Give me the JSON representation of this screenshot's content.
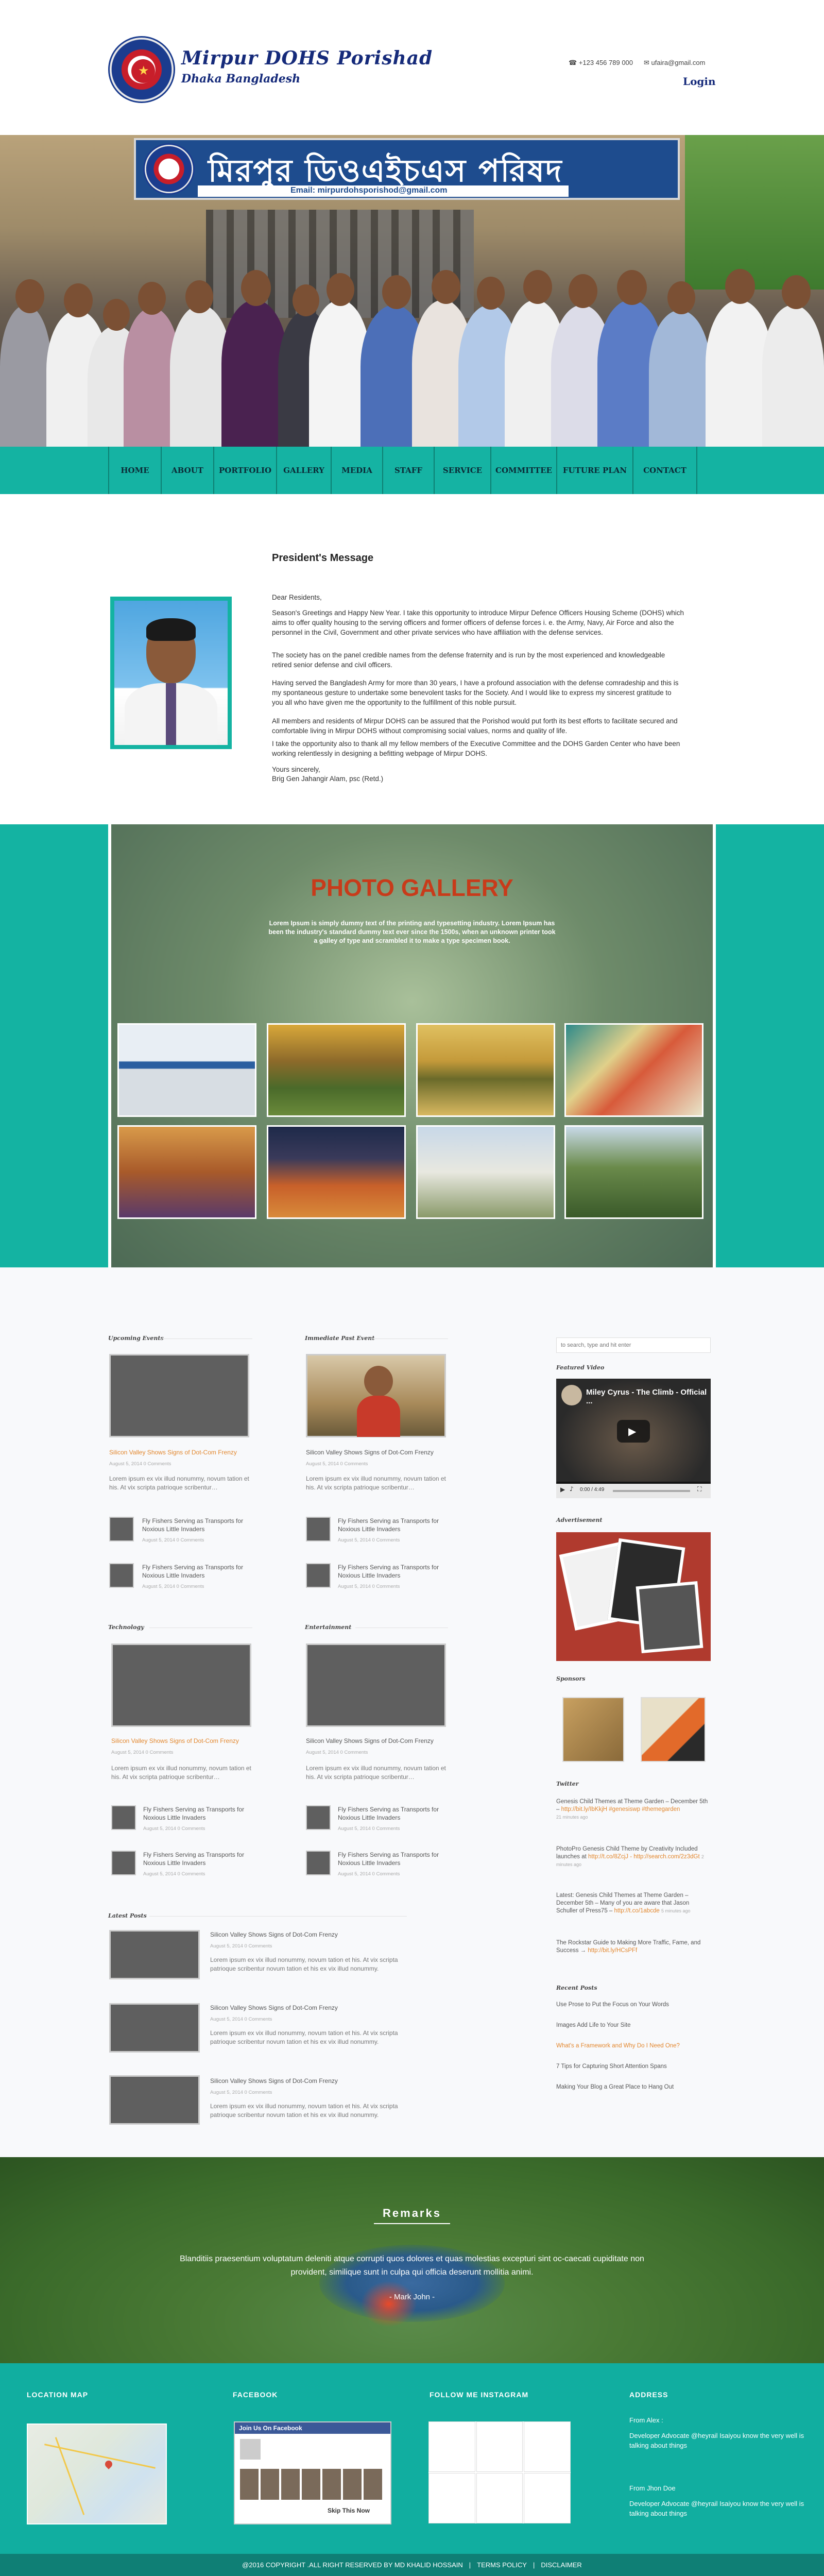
{
  "header": {
    "site_title": "Mirpur DOHS Porishad",
    "site_subtitle": "Dhaka Bangladesh",
    "phone": "+123 456 789 000",
    "email": "ufaira@gmail.com",
    "login": "Login"
  },
  "hero": {
    "sign_text": "মিরপুর ডিওএইচএস পরিষদ",
    "sign_email": "Email: mirpurdohsporishod@gmail.com"
  },
  "nav": [
    "HOME",
    "ABOUT",
    "PORTFOLIO",
    "GALLERY",
    "MEDIA",
    "STAFF",
    "SERVICE",
    "COMMITTEE",
    "FUTURE PLAN",
    "CONTACT"
  ],
  "president": {
    "title": "President's Message",
    "salutation": "Dear Residents,",
    "p1": "Season's Greetings and Happy New Year. I take this opportunity to introduce Mirpur Defence Officers Housing Scheme (DOHS) which aims to offer quality housing to the serving officers and former officers of defense forces i. e. the Army, Navy, Air Force and also the personnel in the Civil, Government and other private services who have affiliation with the defense services.",
    "p2": "The society has on the panel credible names from the defense fraternity and is run by the most experienced and knowledgeable retired senior defense and civil officers.",
    "p3": "Having served the Bangladesh Army for more than 30 years, I have a profound association with the defense comradeship and this is my spontaneous gesture to undertake some benevolent tasks for the Society. And I would like to express my sincerest gratitude to you all who have given me the opportunity to the fulfillment of this noble pursuit.",
    "p4": "All members and residents of Mirpur DOHS can be assured that the Porishod would put forth its best efforts to facilitate secured and comfortable living in Mirpur DOHS without compromising social values, norms and quality of life.",
    "p5": "I take the opportunity also to thank all my fellow members of the Executive Committee and the DOHS Garden Center who have been working relentlessly in designing a befitting webpage of Mirpur DOHS.",
    "closing": "Yours sincerely,",
    "signature": "Brig Gen Jahangir Alam, psc (Retd.)"
  },
  "gallery": {
    "title": "PHOTO GALLERY",
    "description": "Lorem Ipsum is simply dummy text of the printing and typesetting industry. Lorem Ipsum has been the industry's standard dummy text ever since the 1500s, when an unknown printer took a galley of type and scrambled it to make a type specimen book."
  },
  "content": {
    "upcoming_label": "Upcoming Events",
    "immediate_label": "Immediate Past Event",
    "technology_label": "Technology",
    "entertainment_label": "Entertainment",
    "latest_label": "Latest Posts",
    "main_title": "Silicon Valley Shows Signs of Dot-Com Frenzy",
    "main_meta": "August 5, 2014   0 Comments",
    "main_text": "Lorem ipsum ex vix illud nonummy, novum tation et his. At vix scripta patrioque scribentur…",
    "small_title": "Fly Fishers Serving as Transports for Noxious Little Invaders",
    "small_meta": "August 5, 2014   0 Comments",
    "latest_text": "Lorem ipsum ex vix illud nonummy, novum tation et his. At vix scripta patrioque scribentur novum tation et his ex vix illud nonummy."
  },
  "sidebar": {
    "search_placeholder": "to search, type and hit enter",
    "featured_label": "Featured Video",
    "video_title": "Miley Cyrus - The Climb - Official ...",
    "video_time": "0:00 / 4:49",
    "advertisement_label": "Advertisement",
    "sponsors_label": "Sponsors",
    "twitter_label": "Twitter",
    "tweets": [
      {
        "text": "Genesis Child Themes at Theme Garden – December 5th –",
        "link": "http://bit.ly/IbKkjH #genesiswp #themegarden",
        "time": "21 minutes ago"
      },
      {
        "text": "PhotoPro Genesis Child Theme by Creativity Included launches at",
        "link": "http://t.co/8ZcjJ - http://search.com/2z3dGt",
        "time": "2 minutes ago"
      },
      {
        "text": "Latest: Genesis Child Themes at Theme Garden – December 5th – Many of you are aware that Jason Schuller of Press75 –",
        "link": "http://t.co/1abcde",
        "time": "5 minutes ago"
      },
      {
        "text": "The Rockstar Guide to Making More Traffic, Fame, and Success →",
        "link": "http://bit.ly/HCsPFf",
        "time": ""
      }
    ],
    "recent_label": "Recent Posts",
    "recent": [
      "Use Prose to Put the Focus on Your Words",
      "Images Add Life to Your Site",
      "What's a Framework and Why Do I Need One?",
      "7 Tips for Capturing Short Attention Spans",
      "Making Your Blog a Great Place to Hang Out"
    ]
  },
  "remarks": {
    "title": "Remarks",
    "text": "Blanditiis praesentium voluptatum deleniti atque corrupti quos dolores et quas molestias excepturi sint oc-caecati cupiditate non provident, similique sunt in culpa qui officia deserunt mollitia animi.",
    "author": "- Mark John -"
  },
  "footer": {
    "location_label": "LOCATION MAP",
    "facebook_label": "FACEBOOK",
    "instagram_label": "FOLLOW ME INSTAGRAM",
    "address_label": "ADDRESS",
    "fb_join": "Join Us On Facebook",
    "fb_skip": "Skip This Now",
    "from1": "From Alex :",
    "text1": "Developer Advocate @heyrail Isaiyou know the very well is talking about things",
    "from2": "From Jhon Doe",
    "text2": "Developer Advocate @heyrail Isaiyou know the very well is talking about things",
    "copyright": "@2016 COPYRIGHT .ALL RIGHT RESERVED BY MD KHALID HOSSAIN",
    "terms": "TERMS POLICY",
    "disclaimer": "DISCLAIMER"
  }
}
